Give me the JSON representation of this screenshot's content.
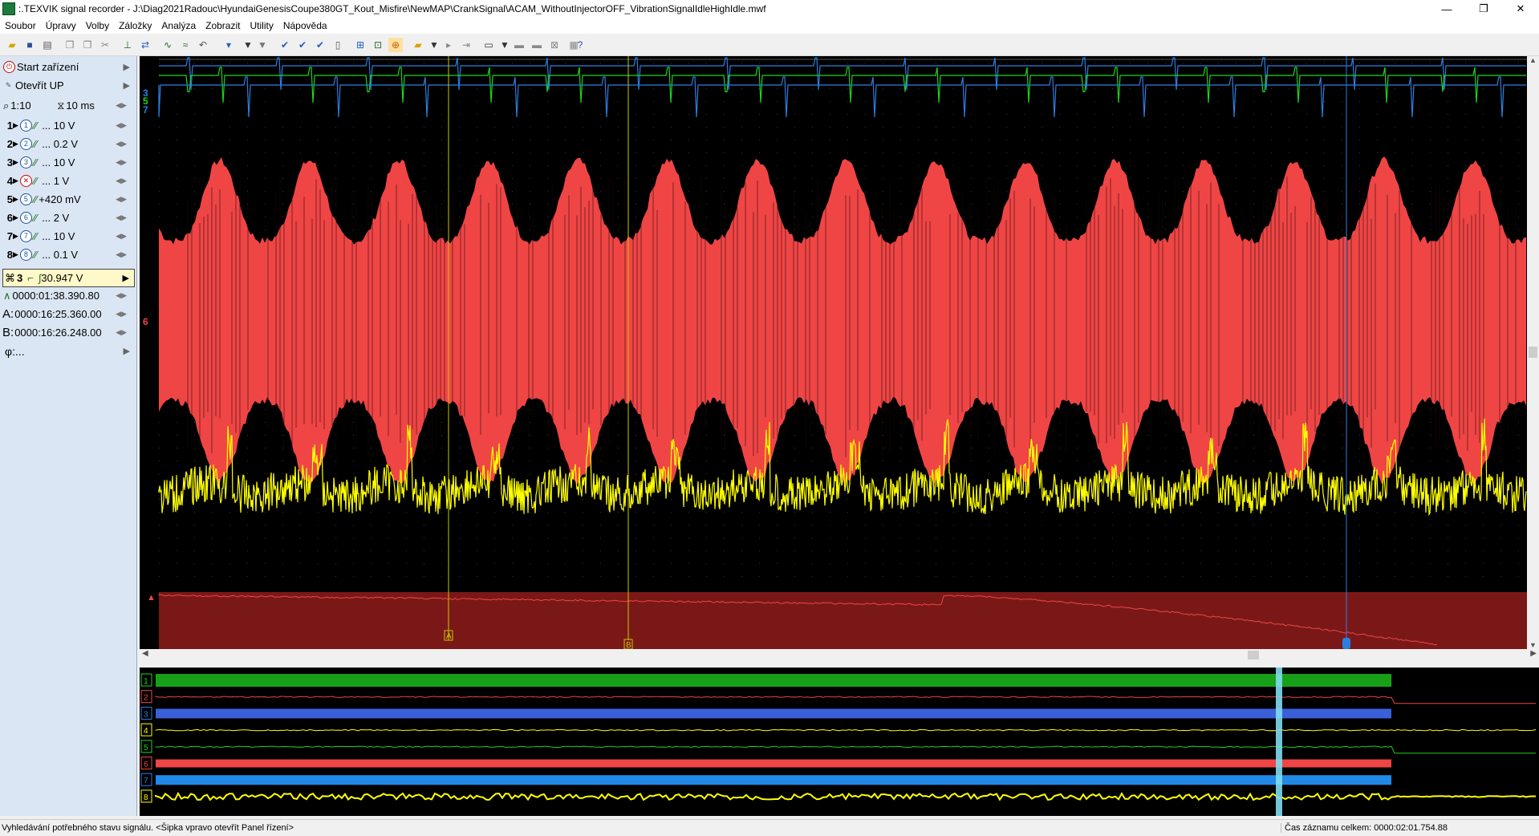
{
  "window": {
    "title": ":.TEXVIK  signal recorder - J:\\Diag2021Radouc\\HyundaiGenesisCoupe380GT_Kout_Misfire\\NewMAP\\CrankSignal\\ACAM_WithoutInjectorOFF_VibrationSignalIdleHighIdle.mwf",
    "minimize": "—",
    "maximize": "❐",
    "close": "✕"
  },
  "menu": [
    "Soubor",
    "Úpravy",
    "Volby",
    "Záložky",
    "Analýza",
    "Zobrazit",
    "Utility",
    "Nápověda"
  ],
  "side_panel": {
    "start_label": "Start zařízení",
    "open_label": "Otevřít UP",
    "zoom_value": "1:10",
    "time_per_div": "10 ms",
    "channels": [
      {
        "n": "1",
        "range": "... 10 V"
      },
      {
        "n": "2",
        "range": "... 0.2 V"
      },
      {
        "n": "3",
        "range": "... 10 V"
      },
      {
        "n": "4",
        "range": "... 1 V"
      },
      {
        "n": "5",
        "range": "+420 mV"
      },
      {
        "n": "6",
        "range": "... 2 V"
      },
      {
        "n": "7",
        "range": "... 10 V"
      },
      {
        "n": "8",
        "range": "... 0.1 V"
      }
    ],
    "trigger_channel": "3",
    "trigger_value": "30.947 V",
    "trigger_time": "0000:01:38.390.80",
    "cursor_a": "0000:16:25.360.00",
    "cursor_b": "0000:16:26.248.00",
    "phi_label": "φ:...",
    "cursor_a_prefix": "A:",
    "cursor_b_prefix": "B:"
  },
  "plot": {
    "channel_markers": [
      "3",
      "5",
      "7"
    ],
    "red_channel_marker": "6",
    "cursor_labels": [
      "A",
      "B"
    ],
    "colors": {
      "red": "#f04545",
      "yellow": "#ffff00",
      "green": "#1ed41e",
      "blue": "#2a7fe0",
      "dark_red": "#7a1818"
    }
  },
  "overview": {
    "channels": [
      "1",
      "2",
      "3",
      "4",
      "5",
      "6",
      "7",
      "8"
    ]
  },
  "status": {
    "left": "Vyhledávání potřebného stavu signálu. <Šipka vpravo otevřít Panel řízení>",
    "right": "Čas záznamu celkem: 0000:02:01.754.88"
  }
}
